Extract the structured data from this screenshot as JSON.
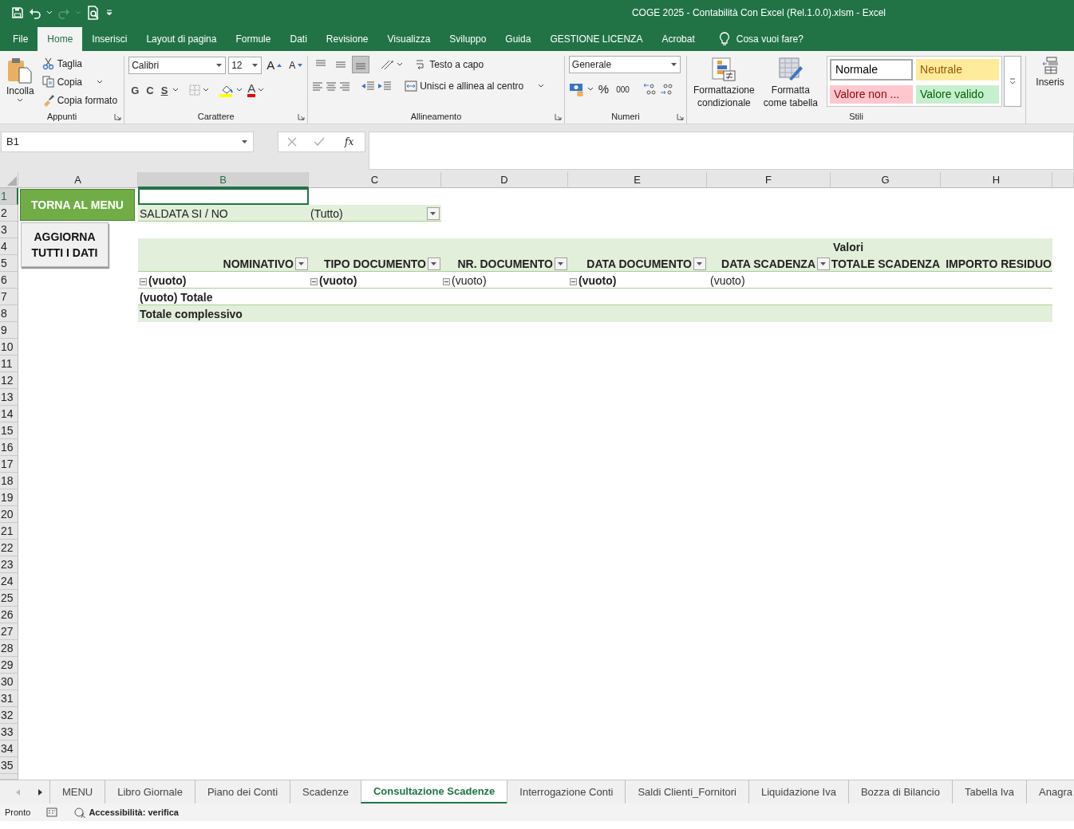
{
  "window": {
    "title": "COGE 2025 - Contabilità Con Excel (Rel.1.0.0).xlsm  -  Excel"
  },
  "ribbon_tabs": [
    {
      "label": "File",
      "selected": false
    },
    {
      "label": "Home",
      "selected": true
    },
    {
      "label": "Inserisci",
      "selected": false
    },
    {
      "label": "Layout di pagina",
      "selected": false
    },
    {
      "label": "Formule",
      "selected": false
    },
    {
      "label": "Dati",
      "selected": false
    },
    {
      "label": "Revisione",
      "selected": false
    },
    {
      "label": "Visualizza",
      "selected": false
    },
    {
      "label": "Sviluppo",
      "selected": false
    },
    {
      "label": "Guida",
      "selected": false
    },
    {
      "label": "GESTIONE LICENZA",
      "selected": false
    },
    {
      "label": "Acrobat",
      "selected": false
    }
  ],
  "tell_me": "Cosa vuoi fare?",
  "clipboard": {
    "paste": "Incolla",
    "items": [
      {
        "label": "Taglia",
        "kind": "cut"
      },
      {
        "label": "Copia",
        "kind": "copy"
      },
      {
        "label": "Copia formato",
        "kind": "painter"
      }
    ],
    "label": "Appunti"
  },
  "font": {
    "name": "Calibri",
    "size": "12",
    "size_buttons": [
      {
        "label": "A",
        "kind": "grow"
      },
      {
        "label": "A",
        "kind": "shrink"
      }
    ],
    "style_buttons": [
      {
        "label": "G",
        "kind": "bold"
      },
      {
        "label": "C",
        "kind": "italic"
      },
      {
        "label": "S",
        "kind": "underline"
      }
    ],
    "color_button": "A",
    "label": "Carattere"
  },
  "alignment": {
    "vertical": [
      {
        "kind": "top",
        "selected": false
      },
      {
        "kind": "middle",
        "selected": false
      },
      {
        "kind": "bottom",
        "selected": true
      }
    ],
    "wrap": "Testo a capo",
    "merge": "Unisci e allinea al centro",
    "label": "Allineamento"
  },
  "number": {
    "format": "Generale",
    "buttons": [
      "%",
      "000"
    ],
    "label": "Numeri"
  },
  "styles": {
    "conditional": "Formattazione condizionale",
    "table": "Formatta come tabella",
    "gallery": [
      {
        "label": "Normale",
        "kind": "normal"
      },
      {
        "label": "Neutrale",
        "kind": "neutral"
      },
      {
        "label": "Valore non ...",
        "kind": "bad"
      },
      {
        "label": "Valore valido",
        "kind": "good"
      }
    ],
    "label": "Stili"
  },
  "cells": {
    "insert": "Inseris"
  },
  "formula_bar": {
    "name_box": "B1",
    "fx": "fx"
  },
  "columns": [
    {
      "label": "A",
      "selected": false
    },
    {
      "label": "B",
      "selected": true
    },
    {
      "label": "C",
      "selected": false
    },
    {
      "label": "D",
      "selected": false
    },
    {
      "label": "E",
      "selected": false
    },
    {
      "label": "F",
      "selected": false
    },
    {
      "label": "G",
      "selected": false
    },
    {
      "label": "H",
      "selected": false
    }
  ],
  "rows": [
    {
      "label": "1",
      "selected": true
    },
    {
      "label": "2",
      "selected": false
    },
    {
      "label": "3",
      "selected": false
    },
    {
      "label": "4",
      "selected": false
    },
    {
      "label": "5",
      "selected": false
    },
    {
      "label": "6",
      "selected": false
    },
    {
      "label": "7",
      "selected": false
    },
    {
      "label": "8",
      "selected": false
    },
    {
      "label": "9",
      "selected": false
    },
    {
      "label": "10",
      "selected": false
    },
    {
      "label": "11",
      "selected": false
    },
    {
      "label": "12",
      "selected": false
    },
    {
      "label": "13",
      "selected": false
    },
    {
      "label": "14",
      "selected": false
    },
    {
      "label": "15",
      "selected": false
    },
    {
      "label": "16",
      "selected": false
    },
    {
      "label": "17",
      "selected": false
    },
    {
      "label": "18",
      "selected": false
    },
    {
      "label": "19",
      "selected": false
    },
    {
      "label": "20",
      "selected": false
    },
    {
      "label": "21",
      "selected": false
    },
    {
      "label": "22",
      "selected": false
    },
    {
      "label": "23",
      "selected": false
    },
    {
      "label": "24",
      "selected": false
    },
    {
      "label": "25",
      "selected": false
    },
    {
      "label": "26",
      "selected": false
    },
    {
      "label": "27",
      "selected": false
    },
    {
      "label": "28",
      "selected": false
    },
    {
      "label": "29",
      "selected": false
    },
    {
      "label": "30",
      "selected": false
    },
    {
      "label": "31",
      "selected": false
    },
    {
      "label": "32",
      "selected": false
    },
    {
      "label": "33",
      "selected": false
    },
    {
      "label": "34",
      "selected": false
    },
    {
      "label": "35",
      "selected": false
    }
  ],
  "shape_buttons": [
    {
      "label": "TORNA AL MENU",
      "kind": "green"
    },
    {
      "label": "AGGIORNA TUTTI I DATI",
      "kind": "grey"
    }
  ],
  "pivot": {
    "filter": {
      "label": "SALDATA SI / NO",
      "value": "(Tutto)"
    },
    "values_caption": "Valori",
    "headers": [
      {
        "label": "NOMINATIVO",
        "filter": true
      },
      {
        "label": "TIPO DOCUMENTO",
        "filter": true
      },
      {
        "label": "NR. DOCUMENTO",
        "filter": true
      },
      {
        "label": "DATA DOCUMENTO",
        "filter": true
      },
      {
        "label": "DATA SCADENZA",
        "filter": true
      },
      {
        "label": "TOTALE SCADENZA",
        "filter": false
      },
      {
        "label": "IMPORTO RESIDUO",
        "filter": false
      }
    ],
    "rows": [
      {
        "kind": "item",
        "cells": [
          {
            "text": "(vuoto)",
            "bold": true,
            "kind": "outline",
            "expanded": true
          },
          {
            "text": "(vuoto)",
            "bold": true,
            "kind": "outline",
            "expanded": true
          },
          {
            "text": "(vuoto)",
            "bold": false,
            "kind": "outline",
            "expanded": true
          },
          {
            "text": "(vuoto)",
            "bold": true,
            "kind": "outline",
            "expanded": true
          },
          {
            "text": "(vuoto)",
            "bold": false,
            "kind": "plain"
          }
        ]
      },
      {
        "kind": "subtotal",
        "label": "(vuoto) Totale"
      },
      {
        "kind": "grand_total",
        "label": "Totale complessivo"
      }
    ]
  },
  "sheet_tabs": [
    {
      "label": "MENU",
      "selected": false
    },
    {
      "label": "Libro Giornale",
      "selected": false
    },
    {
      "label": "Piano dei Conti",
      "selected": false
    },
    {
      "label": "Scadenze",
      "selected": false
    },
    {
      "label": "Consultazione Scadenze",
      "selected": true
    },
    {
      "label": "Interrogazione Conti",
      "selected": false
    },
    {
      "label": "Saldi Clienti_Fornitori",
      "selected": false
    },
    {
      "label": "Liquidazione Iva",
      "selected": false
    },
    {
      "label": "Bozza di Bilancio",
      "selected": false
    },
    {
      "label": "Tabella Iva",
      "selected": false
    },
    {
      "label": "Anagra",
      "selected": false
    }
  ],
  "status_bar": {
    "mode": "Pronto",
    "accessibility": "Accessibilità: verifica"
  }
}
